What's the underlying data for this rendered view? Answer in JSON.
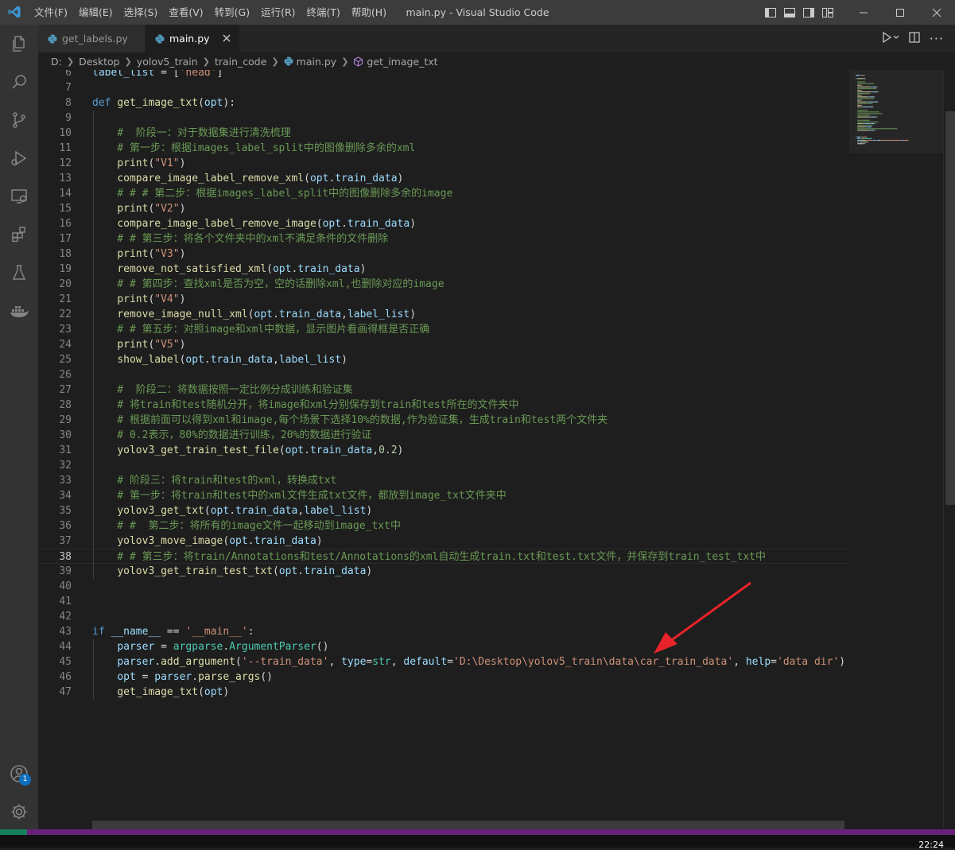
{
  "window": {
    "title": "main.py - Visual Studio Code",
    "menu": [
      "文件(F)",
      "编辑(E)",
      "选择(S)",
      "查看(V)",
      "转到(G)",
      "运行(R)",
      "终端(T)",
      "帮助(H)"
    ]
  },
  "activity_bar": {
    "items": [
      "explorer-icon",
      "search-icon",
      "source-control-icon",
      "run-debug-icon",
      "remote-explorer-icon",
      "extensions-icon",
      "testing-icon",
      "docker-icon"
    ],
    "accounts_badge": "1"
  },
  "tabs": [
    {
      "label": "get_labels.py",
      "active": false
    },
    {
      "label": "main.py",
      "active": true
    }
  ],
  "breadcrumb": [
    "D:",
    "Desktop",
    "yolov5_train",
    "train_code",
    "main.py",
    "get_image_txt"
  ],
  "editor": {
    "current_line": 38,
    "lines": [
      {
        "n": 6,
        "tokens": [
          [
            "var",
            "label_list"
          ],
          [
            "op",
            " = ["
          ],
          [
            "str",
            "'head'"
          ],
          [
            "op",
            "]"
          ]
        ]
      },
      {
        "n": 7,
        "tokens": []
      },
      {
        "n": 8,
        "tokens": [
          [
            "kw",
            "def"
          ],
          [
            "op",
            " "
          ],
          [
            "fn",
            "get_image_txt"
          ],
          [
            "op",
            "("
          ],
          [
            "var",
            "opt"
          ],
          [
            "op",
            "):"
          ]
        ]
      },
      {
        "n": 9,
        "tokens": []
      },
      {
        "n": 10,
        "tokens": [
          [
            "cm",
            "    #  阶段一：对于数据集进行清洗梳理"
          ]
        ]
      },
      {
        "n": 11,
        "tokens": [
          [
            "cm",
            "    # 第一步：根据images_label_split中的图像删除多余的xml"
          ]
        ]
      },
      {
        "n": 12,
        "tokens": [
          [
            "op",
            "    "
          ],
          [
            "fn",
            "print"
          ],
          [
            "op",
            "("
          ],
          [
            "str",
            "\"V1\""
          ],
          [
            "op",
            ")"
          ]
        ]
      },
      {
        "n": 13,
        "tokens": [
          [
            "op",
            "    "
          ],
          [
            "fn",
            "compare_image_label_remove_xml"
          ],
          [
            "op",
            "("
          ],
          [
            "var",
            "opt"
          ],
          [
            "op",
            "."
          ],
          [
            "var",
            "train_data"
          ],
          [
            "op",
            ")"
          ]
        ]
      },
      {
        "n": 14,
        "tokens": [
          [
            "cm",
            "    # # # 第二步：根据images_label_split中的图像删除多余的image"
          ]
        ]
      },
      {
        "n": 15,
        "tokens": [
          [
            "op",
            "    "
          ],
          [
            "fn",
            "print"
          ],
          [
            "op",
            "("
          ],
          [
            "str",
            "\"V2\""
          ],
          [
            "op",
            ")"
          ]
        ]
      },
      {
        "n": 16,
        "tokens": [
          [
            "op",
            "    "
          ],
          [
            "fn",
            "compare_image_label_remove_image"
          ],
          [
            "op",
            "("
          ],
          [
            "var",
            "opt"
          ],
          [
            "op",
            "."
          ],
          [
            "var",
            "train_data"
          ],
          [
            "op",
            ")"
          ]
        ]
      },
      {
        "n": 17,
        "tokens": [
          [
            "cm",
            "    # # 第三步：将各个文件夹中的xml不满足条件的文件删除"
          ]
        ]
      },
      {
        "n": 18,
        "tokens": [
          [
            "op",
            "    "
          ],
          [
            "fn",
            "print"
          ],
          [
            "op",
            "("
          ],
          [
            "str",
            "\"V3\""
          ],
          [
            "op",
            ")"
          ]
        ]
      },
      {
        "n": 19,
        "tokens": [
          [
            "op",
            "    "
          ],
          [
            "fn",
            "remove_not_satisfied_xml"
          ],
          [
            "op",
            "("
          ],
          [
            "var",
            "opt"
          ],
          [
            "op",
            "."
          ],
          [
            "var",
            "train_data"
          ],
          [
            "op",
            ")"
          ]
        ]
      },
      {
        "n": 20,
        "tokens": [
          [
            "cm",
            "    # # 第四步：查找xml是否为空，空的话删除xml,也删除对应的image"
          ]
        ]
      },
      {
        "n": 21,
        "tokens": [
          [
            "op",
            "    "
          ],
          [
            "fn",
            "print"
          ],
          [
            "op",
            "("
          ],
          [
            "str",
            "\"V4\""
          ],
          [
            "op",
            ")"
          ]
        ]
      },
      {
        "n": 22,
        "tokens": [
          [
            "op",
            "    "
          ],
          [
            "fn",
            "remove_image_null_xml"
          ],
          [
            "op",
            "("
          ],
          [
            "var",
            "opt"
          ],
          [
            "op",
            "."
          ],
          [
            "var",
            "train_data"
          ],
          [
            "op",
            ","
          ],
          [
            "var",
            "label_list"
          ],
          [
            "op",
            ")"
          ]
        ]
      },
      {
        "n": 23,
        "tokens": [
          [
            "cm",
            "    # # 第五步：对照image和xml中数据，显示图片看画得框是否正确"
          ]
        ]
      },
      {
        "n": 24,
        "tokens": [
          [
            "op",
            "    "
          ],
          [
            "fn",
            "print"
          ],
          [
            "op",
            "("
          ],
          [
            "str",
            "\"V5\""
          ],
          [
            "op",
            ")"
          ]
        ]
      },
      {
        "n": 25,
        "tokens": [
          [
            "op",
            "    "
          ],
          [
            "fn",
            "show_label"
          ],
          [
            "op",
            "("
          ],
          [
            "var",
            "opt"
          ],
          [
            "op",
            "."
          ],
          [
            "var",
            "train_data"
          ],
          [
            "op",
            ","
          ],
          [
            "var",
            "label_list"
          ],
          [
            "op",
            ")"
          ]
        ]
      },
      {
        "n": 26,
        "tokens": []
      },
      {
        "n": 27,
        "tokens": [
          [
            "cm",
            "    #  阶段二：将数据按照一定比例分成训练和验证集"
          ]
        ]
      },
      {
        "n": 28,
        "tokens": [
          [
            "cm",
            "    # 将train和test随机分开，将image和xml分别保存到train和test所在的文件夹中"
          ]
        ]
      },
      {
        "n": 29,
        "tokens": [
          [
            "cm",
            "    # 根据前面可以得到xml和image,每个场景下选择10%的数据,作为验证集，生成train和test两个文件夹"
          ]
        ]
      },
      {
        "n": 30,
        "tokens": [
          [
            "cm",
            "    # 0.2表示，80%的数据进行训练，20%的数据进行验证"
          ]
        ]
      },
      {
        "n": 31,
        "tokens": [
          [
            "op",
            "    "
          ],
          [
            "fn",
            "yolov3_get_train_test_file"
          ],
          [
            "op",
            "("
          ],
          [
            "var",
            "opt"
          ],
          [
            "op",
            "."
          ],
          [
            "var",
            "train_data"
          ],
          [
            "op",
            ","
          ],
          [
            "num",
            "0.2"
          ],
          [
            "op",
            ")"
          ]
        ]
      },
      {
        "n": 32,
        "tokens": []
      },
      {
        "n": 33,
        "tokens": [
          [
            "cm",
            "    # 阶段三：将train和test的xml，转换成txt"
          ]
        ]
      },
      {
        "n": 34,
        "tokens": [
          [
            "cm",
            "    # 第一步：将train和test中的xml文件生成txt文件，都放到image_txt文件夹中"
          ]
        ]
      },
      {
        "n": 35,
        "tokens": [
          [
            "op",
            "    "
          ],
          [
            "fn",
            "yolov3_get_txt"
          ],
          [
            "op",
            "("
          ],
          [
            "var",
            "opt"
          ],
          [
            "op",
            "."
          ],
          [
            "var",
            "train_data"
          ],
          [
            "op",
            ","
          ],
          [
            "var",
            "label_list"
          ],
          [
            "op",
            ")"
          ]
        ]
      },
      {
        "n": 36,
        "tokens": [
          [
            "cm",
            "    # #  第二步：将所有的image文件一起移动到image_txt中"
          ]
        ]
      },
      {
        "n": 37,
        "tokens": [
          [
            "op",
            "    "
          ],
          [
            "fn",
            "yolov3_move_image"
          ],
          [
            "op",
            "("
          ],
          [
            "var",
            "opt"
          ],
          [
            "op",
            "."
          ],
          [
            "var",
            "train_data"
          ],
          [
            "op",
            ")"
          ]
        ]
      },
      {
        "n": 38,
        "tokens": [
          [
            "cm",
            "    # # 第三步：将train/Annotations和test/Annotations的xml自动生成train.txt和test.txt文件，并保存到train_test_txt中"
          ]
        ]
      },
      {
        "n": 39,
        "tokens": [
          [
            "op",
            "    "
          ],
          [
            "fn",
            "yolov3_get_train_test_txt"
          ],
          [
            "op",
            "("
          ],
          [
            "var",
            "opt"
          ],
          [
            "op",
            "."
          ],
          [
            "var",
            "train_data"
          ],
          [
            "op",
            ")"
          ]
        ]
      },
      {
        "n": 40,
        "tokens": []
      },
      {
        "n": 41,
        "tokens": []
      },
      {
        "n": 42,
        "tokens": []
      },
      {
        "n": 43,
        "tokens": [
          [
            "kw",
            "if"
          ],
          [
            "op",
            " "
          ],
          [
            "var",
            "__name__"
          ],
          [
            "op",
            " == "
          ],
          [
            "str",
            "'__main__'"
          ],
          [
            "op",
            ":"
          ]
        ]
      },
      {
        "n": 44,
        "tokens": [
          [
            "op",
            "    "
          ],
          [
            "var",
            "parser"
          ],
          [
            "op",
            " = "
          ],
          [
            "cls",
            "argparse"
          ],
          [
            "op",
            "."
          ],
          [
            "cls",
            "ArgumentParser"
          ],
          [
            "op",
            "()"
          ]
        ]
      },
      {
        "n": 45,
        "tokens": [
          [
            "op",
            "    "
          ],
          [
            "var",
            "parser"
          ],
          [
            "op",
            "."
          ],
          [
            "fn",
            "add_argument"
          ],
          [
            "op",
            "("
          ],
          [
            "str",
            "'--train_data'"
          ],
          [
            "op",
            ", "
          ],
          [
            "var",
            "type"
          ],
          [
            "op",
            "="
          ],
          [
            "cls",
            "str"
          ],
          [
            "op",
            ", "
          ],
          [
            "var",
            "default"
          ],
          [
            "op",
            "="
          ],
          [
            "str",
            "'D:\\Desktop\\yolov5_train\\data\\car_train_data'"
          ],
          [
            "op",
            ", "
          ],
          [
            "var",
            "help"
          ],
          [
            "op",
            "="
          ],
          [
            "str",
            "'data dir'"
          ],
          [
            "op",
            ")"
          ]
        ]
      },
      {
        "n": 46,
        "tokens": [
          [
            "op",
            "    "
          ],
          [
            "var",
            "opt"
          ],
          [
            "op",
            " = "
          ],
          [
            "var",
            "parser"
          ],
          [
            "op",
            "."
          ],
          [
            "fn",
            "parse_args"
          ],
          [
            "op",
            "()"
          ]
        ]
      },
      {
        "n": 47,
        "tokens": [
          [
            "op",
            "    "
          ],
          [
            "fn",
            "get_image_txt"
          ],
          [
            "op",
            "("
          ],
          [
            "var",
            "opt"
          ],
          [
            "op",
            ")"
          ]
        ]
      }
    ]
  },
  "taskbar": {
    "clock": "22:24"
  },
  "colors": {
    "annotation_arrow": "#e8232a",
    "status_bar": "#68217a",
    "remote_indicator": "#16825d",
    "accent": "#0e70c0"
  }
}
